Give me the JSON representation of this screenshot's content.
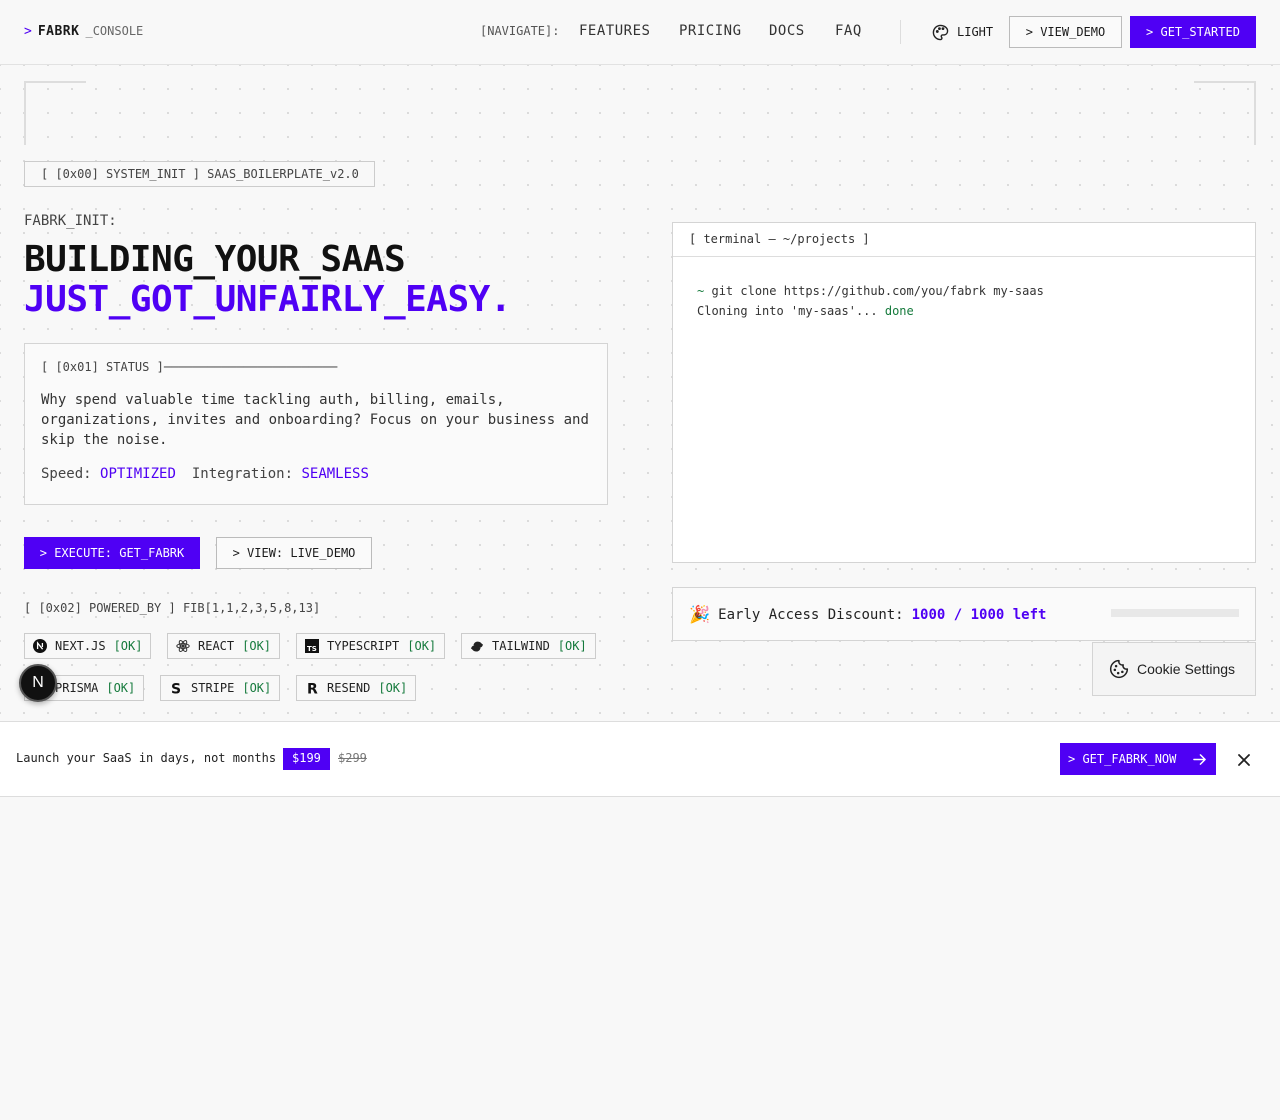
{
  "header": {
    "brand_prompt": ">",
    "brand_name": "FABRK",
    "brand_sub": "_CONSOLE",
    "nav_label": "[NAVIGATE]:",
    "nav": [
      "FEATURES",
      "PRICING",
      "DOCS",
      "FAQ"
    ],
    "theme_label": "LIGHT",
    "view_demo": "> VIEW_DEMO",
    "get_started": "> GET_STARTED"
  },
  "hero": {
    "system_tag": "[ [0x00] SYSTEM_INIT ] SAAS_BOILERPLATE_v2.0",
    "init_label": "FABRK_INIT:",
    "headline_line1": "BUILDING_YOUR_SAAS",
    "headline_line2": "JUST_GOT_UNFAIRLY_EASY.",
    "status": {
      "title": "[ [0x01] STATUS ]────────────────────────",
      "description": "Why spend valuable time tackling auth, billing, emails, organizations, invites and onboarding? Focus on your business and skip the noise.",
      "speed_label": "Speed:",
      "speed_value": "OPTIMIZED",
      "integration_label": "Integration:",
      "integration_value": "SEAMLESS"
    },
    "cta_execute": "> EXECUTE: GET_FABRK",
    "cta_demo": "> VIEW: LIVE_DEMO",
    "powered_by": "[ [0x02] POWERED_BY ] FIB[1,1,2,3,5,8,13]",
    "tech": [
      {
        "name": "NEXT.JS",
        "status": "[OK]"
      },
      {
        "name": "REACT",
        "status": "[OK]"
      },
      {
        "name": "TYPESCRIPT",
        "status": "[OK]"
      },
      {
        "name": "TAILWIND",
        "status": "[OK]"
      },
      {
        "name": "PRISMA",
        "status": "[OK]"
      },
      {
        "name": "STRIPE",
        "status": "[OK]"
      },
      {
        "name": "RESEND",
        "status": "[OK]"
      }
    ]
  },
  "terminal": {
    "title": "[ terminal — ~/projects ]",
    "prompt": "~",
    "command": "git clone https://github.com/you/fabrk my-saas",
    "output": "Cloning into 'my-saas'...",
    "output_status": "done"
  },
  "discount": {
    "emoji": "🎉",
    "label": "Early Access Discount:",
    "value": "1000 / 1000 left",
    "remaining_fraction": 1.0
  },
  "cookie": {
    "label": "Cookie Settings"
  },
  "next_badge": {
    "letter": "N"
  },
  "promo": {
    "message": "Launch your SaaS in days, not months",
    "price": "$199",
    "old_price": "$299",
    "cta": "> GET_FABRK_NOW"
  },
  "colors": {
    "accent": "#4f00f4",
    "ok": "#157a3c"
  }
}
